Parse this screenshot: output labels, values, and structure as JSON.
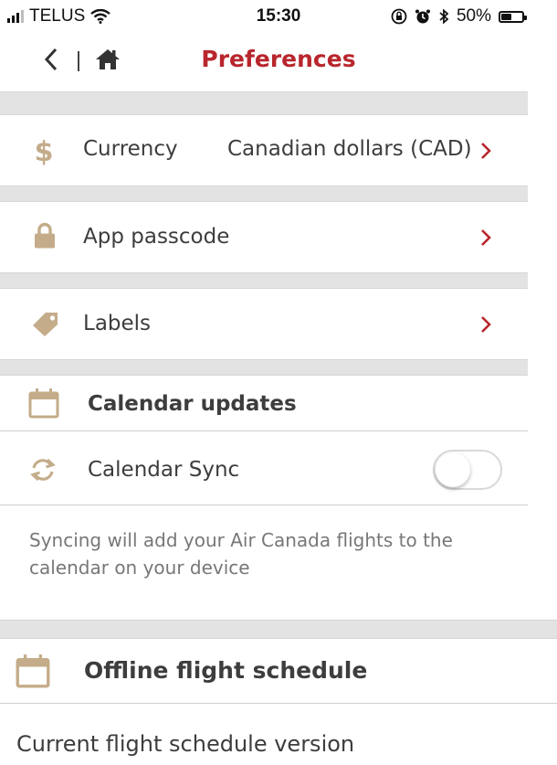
{
  "status_bar": {
    "carrier": "TELUS",
    "time": "15:30",
    "battery": "50%",
    "battery_level": 0.5
  },
  "nav": {
    "title": "Preferences",
    "back_icon": "chevron-left-icon",
    "home_icon": "home-icon"
  },
  "rows": {
    "currency": {
      "label": "Currency",
      "value": "Canadian dollars (CAD)"
    },
    "passcode": {
      "label": "App passcode"
    },
    "labels": {
      "label": "Labels"
    }
  },
  "calendar": {
    "title": "Calendar updates",
    "sync_label": "Calendar Sync",
    "sync_on": false,
    "note": "Syncing will add your Air Canada flights to the calendar on your device"
  },
  "offline": {
    "title": "Offline flight schedule",
    "version_label": "Current flight schedule version"
  },
  "colors": {
    "accent": "#b8262d",
    "icon_tan": "#c4ac8a",
    "separator": "#e3e3e3"
  }
}
